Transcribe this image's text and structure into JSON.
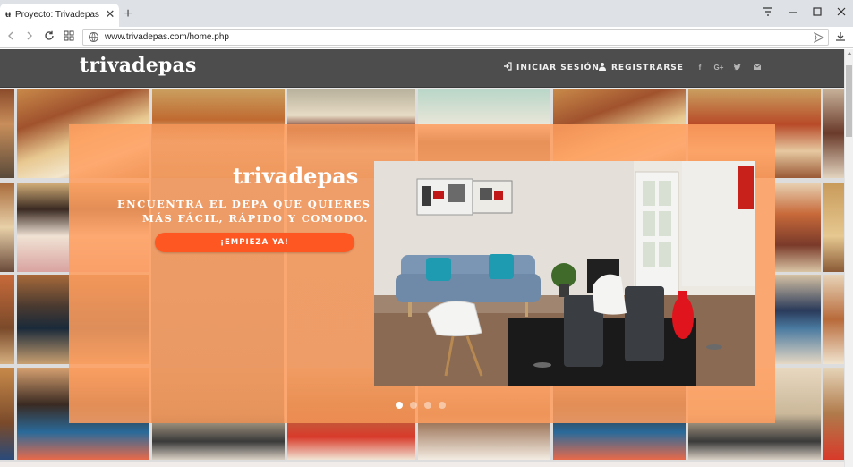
{
  "browser": {
    "tab_title": "Proyecto: Trivadepas",
    "favicon_glyph": "ʉ",
    "url": "www.trivadepas.com/home.php"
  },
  "header": {
    "logo": "trivadepas",
    "nav": {
      "login": "INICIAR SESIÓN",
      "register": "REGISTRARSE"
    },
    "social": {
      "facebook_glyph": "f",
      "googleplus_glyph": "G+"
    }
  },
  "hero": {
    "brand": "trivadepas",
    "tagline_line1": "ENCUENTRA EL DEPA QUE QUIERES",
    "tagline_line2": "MÁS FÁCIL, RÁPIDO Y COMODO.",
    "cta": "¡EMPIEZA YA!",
    "slides_total": 4,
    "active_slide": 1
  },
  "colors": {
    "header_bg": "#4d4d4d",
    "overlay": "#ff9e60",
    "cta": "#ff5722"
  }
}
